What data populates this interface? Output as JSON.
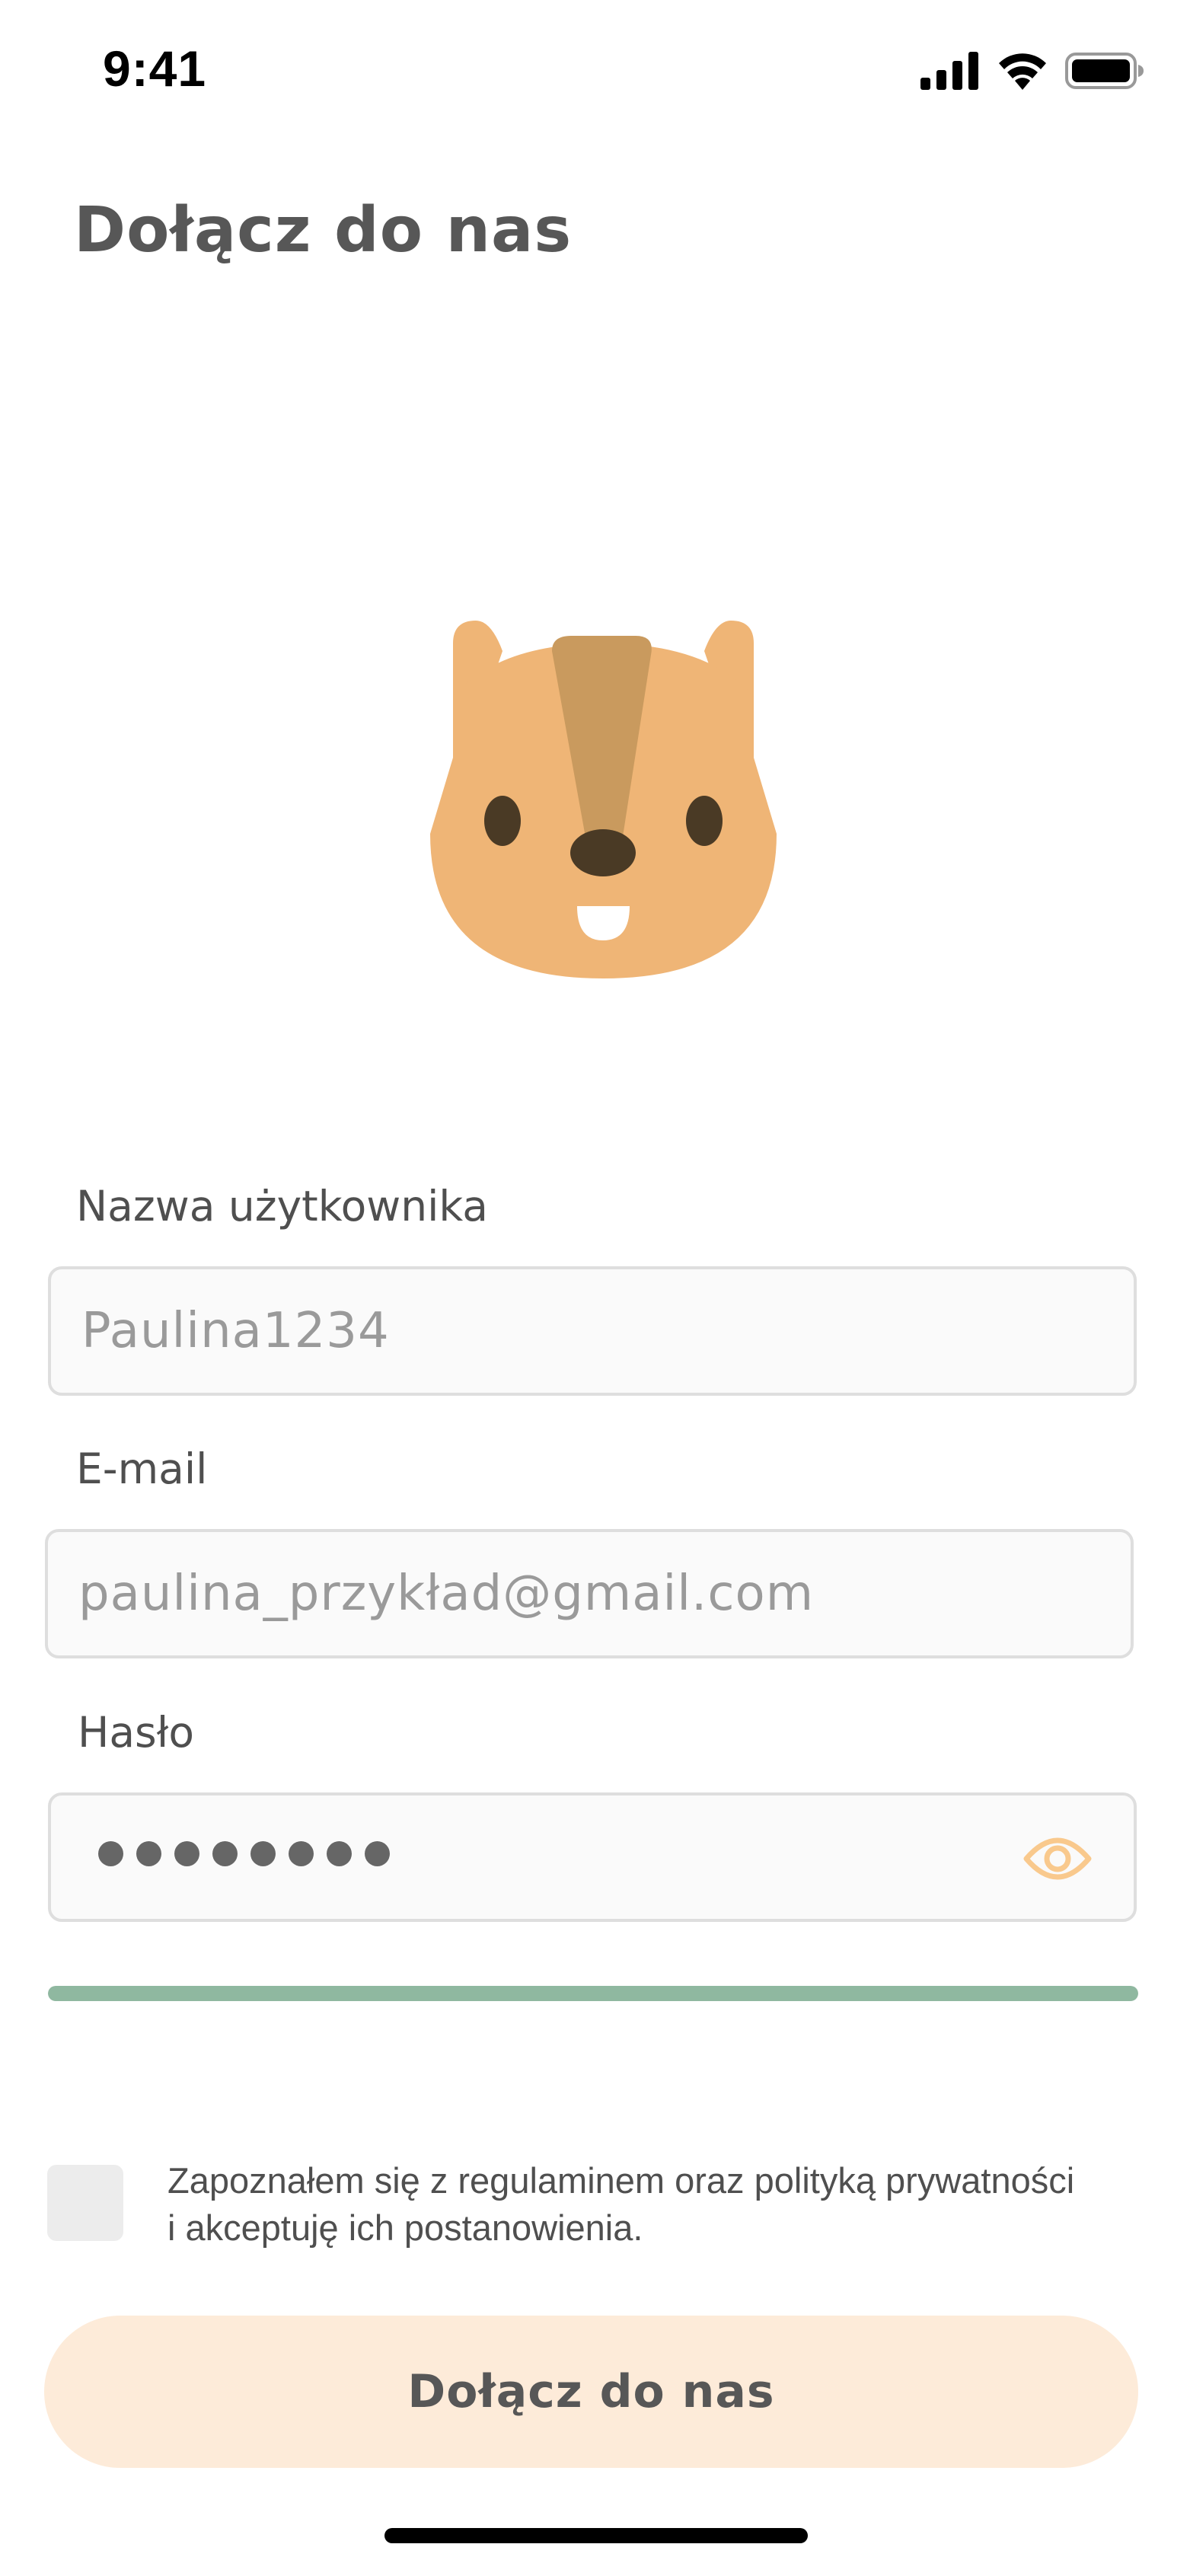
{
  "status_bar": {
    "time": "9:41"
  },
  "page": {
    "title": "Dołącz do nas"
  },
  "form": {
    "username": {
      "label": "Nazwa użytkownika",
      "placeholder": "Paulina1234"
    },
    "email": {
      "label": "E-mail",
      "placeholder": "paulina_przykład@gmail.com"
    },
    "password": {
      "label": "Hasło",
      "masked_length": 8
    },
    "password_strength": {
      "fill_fraction": 1.0,
      "color": "#8fb8a0"
    },
    "terms": {
      "line1": "Zapoznałem się z regulaminem oraz polityką prywatności",
      "line2": "i akceptuję ich postanowienia.",
      "checked": false
    },
    "submit_label": "Dołącz do nas"
  },
  "icons": {
    "signal": "signal-icon",
    "wifi": "wifi-icon",
    "battery": "battery-icon",
    "eye": "eye-icon",
    "mascot": "chipmunk-mascot"
  },
  "colors": {
    "accent": "#f9c98d",
    "button_bg": "#fdebd9",
    "mascot_body": "#efb576",
    "mascot_stripe": "#c99a5e",
    "mascot_dark": "#4a3a25"
  }
}
